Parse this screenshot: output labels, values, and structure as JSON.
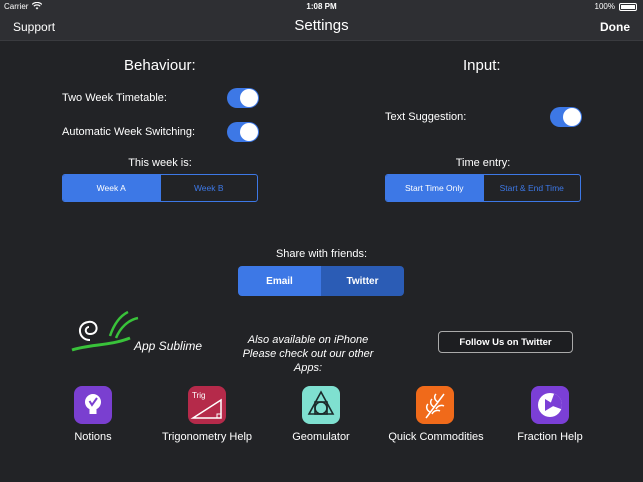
{
  "status": {
    "carrier": "Carrier",
    "time": "1:08 PM",
    "battery": "100%"
  },
  "nav": {
    "left": "Support",
    "title": "Settings",
    "right": "Done"
  },
  "behaviour": {
    "title": "Behaviour:",
    "two_week_label": "Two Week Timetable:",
    "two_week_on": true,
    "auto_switch_label": "Automatic Week Switching:",
    "auto_switch_on": true,
    "week_title": "This week is:",
    "week_options": [
      "Week A",
      "Week B"
    ],
    "week_selected": "Week A"
  },
  "input": {
    "title": "Input:",
    "suggestion_label": "Text Suggestion:",
    "suggestion_on": true,
    "time_title": "Time entry:",
    "time_options": [
      "Start Time Only",
      "Start & End Time"
    ],
    "time_selected": "Start Time Only"
  },
  "share": {
    "title": "Share with friends:",
    "email": "Email",
    "twitter": "Twitter"
  },
  "promo": {
    "logo_text": "App Sublime",
    "also_line1": "Also available on iPhone",
    "also_line2": "Please check out our other Apps:",
    "follow_button": "Follow Us on Twitter"
  },
  "apps": [
    {
      "name": "Notions",
      "icon": "lightbulb-icon",
      "color": "#7a3fd0"
    },
    {
      "name": "Trigonometry Help",
      "icon": "triangle-icon",
      "color": "#b52a4a",
      "badge": "Trig"
    },
    {
      "name": "Geomulator",
      "icon": "shapes-icon",
      "color": "#7fe0d0"
    },
    {
      "name": "Quick Commodities",
      "icon": "wheat-icon",
      "color": "#f06a1a"
    },
    {
      "name": "Fraction Help",
      "icon": "pie-icon",
      "color": "#7b3fd6"
    }
  ],
  "colors": {
    "accent": "#3d78e6",
    "background": "#222326",
    "bar": "#2e2f33"
  }
}
